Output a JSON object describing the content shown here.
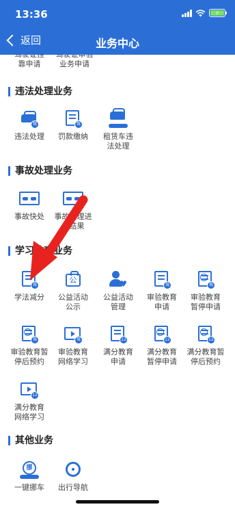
{
  "status_bar": {
    "time": "13:36"
  },
  "nav": {
    "back_label": "返回",
    "title": "业务中心"
  },
  "partial_items": [
    {
      "label": "驾驶证挂\n靠申请"
    },
    {
      "label": "驾驶证审验\n业务申请"
    }
  ],
  "sections": [
    {
      "title": "违法处理业务",
      "items": [
        {
          "label": "违法处理",
          "icon": "car-icon"
        },
        {
          "label": "罚款缴纳",
          "icon": "document-icon"
        },
        {
          "label": "租赁车违\n法处理",
          "icon": "car-hand-icon"
        }
      ]
    },
    {
      "title": "事故处理业务",
      "items": [
        {
          "label": "事故快处",
          "icon": "accident-icon"
        },
        {
          "label": "事故处理进\n度结果",
          "icon": "accident-search-icon"
        }
      ]
    },
    {
      "title": "学习教育业务",
      "items": [
        {
          "label": "学法减分",
          "icon": "document-icon"
        },
        {
          "label": "公益活动\n公示",
          "icon": "charity-icon"
        },
        {
          "label": "公益活动\n管理",
          "icon": "person-heart-icon"
        },
        {
          "label": "审验教育\n申请",
          "icon": "document-icon"
        },
        {
          "label": "审验教育\n暂停申请",
          "icon": "pause-document-icon"
        },
        {
          "label": "审验教育暂\n停后预约",
          "icon": "clock-document-icon"
        },
        {
          "label": "审验教育\n网络学习",
          "icon": "video-icon"
        },
        {
          "label": "满分教育\n申请",
          "icon": "document-icon"
        },
        {
          "label": "满分教育\n暂停申请",
          "icon": "pause-document-icon"
        },
        {
          "label": "满分教育暂\n停后预约",
          "icon": "clock-document-icon"
        },
        {
          "label": "满分教育\n网络学习",
          "icon": "video-icon"
        }
      ]
    },
    {
      "title": "其他业务",
      "items": [
        {
          "label": "一键挪车",
          "icon": "move-car-icon"
        },
        {
          "label": "出行导航",
          "icon": "steering-wheel-icon"
        }
      ]
    }
  ],
  "badges": {
    "driving": "驾",
    "score": "12",
    "move": "挪",
    "charity": "公"
  },
  "colors": {
    "brand": "#2b6fd6",
    "annotation_arrow": "#e8231f"
  }
}
